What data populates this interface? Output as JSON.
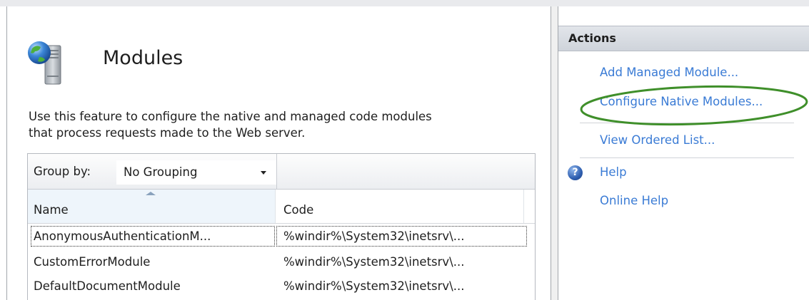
{
  "page": {
    "title": "Modules",
    "description_line1": "Use this feature to configure the native and managed code modules",
    "description_line2": "that process requests made to the Web server.",
    "icon": "modules-icon"
  },
  "grid": {
    "group_by_label": "Group by:",
    "group_by_value": "No Grouping",
    "columns": [
      "Name",
      "Code"
    ],
    "sort": {
      "column": "Name",
      "direction": "ascending"
    },
    "rows": [
      {
        "name": "AnonymousAuthenticationM...",
        "code": "%windir%\\System32\\inetsrv\\..."
      },
      {
        "name": "CustomErrorModule",
        "code": "%windir%\\System32\\inetsrv\\..."
      },
      {
        "name": "DefaultDocumentModule",
        "code": "%windir%\\System32\\inetsrv\\..."
      }
    ]
  },
  "actions": {
    "header": "Actions",
    "links": [
      {
        "label": "Add Managed Module..."
      },
      {
        "label": "Configure Native Modules..."
      },
      {
        "label": "View Ordered List..."
      }
    ],
    "help": [
      {
        "label": "Help",
        "icon": "help-icon"
      },
      {
        "label": "Online Help"
      }
    ]
  },
  "colors": {
    "link": "#3a7bd5",
    "highlight_ellipse": "#3f8f2a",
    "header_bg": "#d6dae0"
  }
}
